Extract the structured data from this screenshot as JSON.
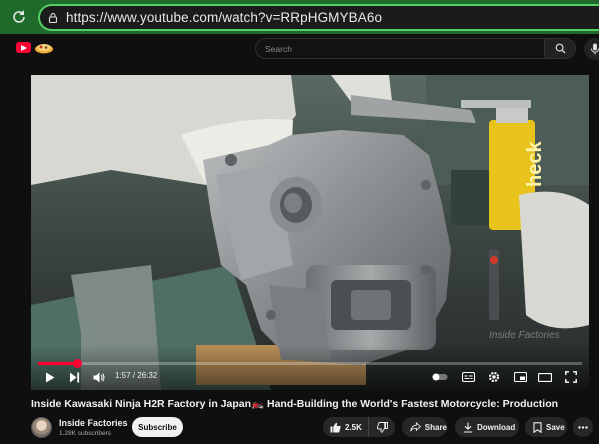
{
  "browser": {
    "url": "https://www.youtube.com/watch?v=RRpHGMYBA6o"
  },
  "masthead": {
    "search_placeholder": "Search"
  },
  "player": {
    "current_time": "1:57",
    "duration": "26:32",
    "time_display": "1:57 / 26:32",
    "progress_fraction": 0.0735,
    "watermark": "Inside Factories",
    "scene_sticker_text": "heck"
  },
  "video": {
    "title": "Inside Kawasaki Ninja H2R Factory in Japan🏍️ Hand-Building the World's Fastest Motorcycle: Production",
    "channel_name": "Inside Factories",
    "subscribers": "1.28K subscribers",
    "subscribe_label": "Subscribe",
    "like_count": "2.5K",
    "share_label": "Share",
    "download_label": "Download",
    "save_label": "Save"
  },
  "colors": {
    "browser_accent": "#53d064",
    "youtube_red": "#ff0033",
    "background": "#0f0f0f"
  },
  "icons": [
    "reload-icon",
    "lock-icon",
    "youtube-logo-icon",
    "search-icon",
    "mic-icon",
    "play-icon",
    "next-icon",
    "volume-icon",
    "subtitles-icon",
    "settings-icon",
    "miniplayer-icon",
    "theater-icon",
    "fullscreen-icon",
    "like-icon",
    "dislike-icon",
    "share-icon",
    "download-icon",
    "save-icon",
    "more-icon"
  ]
}
